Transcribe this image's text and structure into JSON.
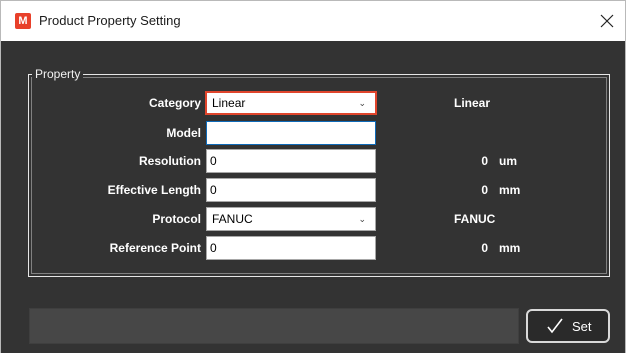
{
  "window": {
    "title": "Product Property Setting",
    "app_icon_letter": "M",
    "accent": "#e8402a"
  },
  "group": {
    "legend": "Property"
  },
  "fields": {
    "category": {
      "label": "Category",
      "value": "Linear",
      "display": "Linear"
    },
    "model": {
      "label": "Model",
      "value": ""
    },
    "resolution": {
      "label": "Resolution",
      "value": "0",
      "display": "0",
      "unit": "um"
    },
    "effective_length": {
      "label": "Effective Length",
      "value": "0",
      "display": "0",
      "unit": "mm"
    },
    "protocol": {
      "label": "Protocol",
      "value": "FANUC",
      "display": "FANUC"
    },
    "reference_point": {
      "label": "Reference Point",
      "value": "0",
      "display": "0",
      "unit": "mm"
    }
  },
  "footer": {
    "status_text": "",
    "set_label": "Set"
  },
  "icons": {
    "close": "close-icon",
    "check": "check-icon",
    "dropdown": "chevron-down-icon"
  }
}
